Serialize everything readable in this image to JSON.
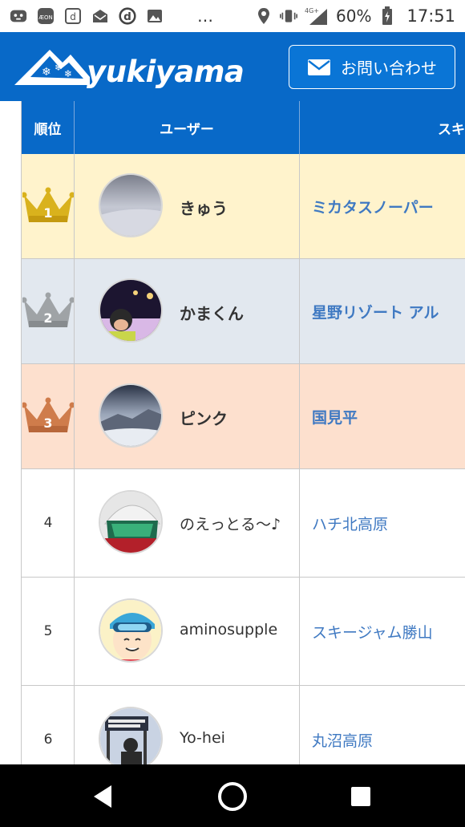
{
  "status_bar": {
    "icons": [
      "game-controller-icon",
      "aeon-app-icon",
      "d-square-icon",
      "mail-icon",
      "d-logo-icon",
      "image-icon"
    ],
    "overflow": "…",
    "network": "4G+",
    "battery": "60%",
    "time": "17:51"
  },
  "header": {
    "logo_text": "yukiyama",
    "contact_label": "お問い合わせ"
  },
  "table": {
    "headers": {
      "rank": "順位",
      "user": "ユーザー",
      "resort": "スキ"
    },
    "rows": [
      {
        "rank": "1",
        "name": "きゅう",
        "resort": "ミカタスノーパー",
        "highlight": "#fff3cc",
        "crown": "gold"
      },
      {
        "rank": "2",
        "name": "かまくん",
        "resort": "星野リゾート アル",
        "highlight": "#e2e8ef",
        "crown": "silver"
      },
      {
        "rank": "3",
        "name": "ピンク",
        "resort": "国見平",
        "highlight": "#fde0ce",
        "crown": "bronze"
      },
      {
        "rank": "4",
        "name": "のえっとる〜♪",
        "resort": "ハチ北高原"
      },
      {
        "rank": "5",
        "name": "aminosupple",
        "resort": "スキージャム勝山"
      },
      {
        "rank": "6",
        "name": "Yo-hei",
        "resort": "丸沼高原"
      }
    ]
  },
  "colors": {
    "brand_blue": "#0869c8",
    "link_blue": "#3f79c2",
    "gold": "#d9b21d",
    "silver": "#9fa3a6",
    "bronze": "#cf7c4b"
  }
}
